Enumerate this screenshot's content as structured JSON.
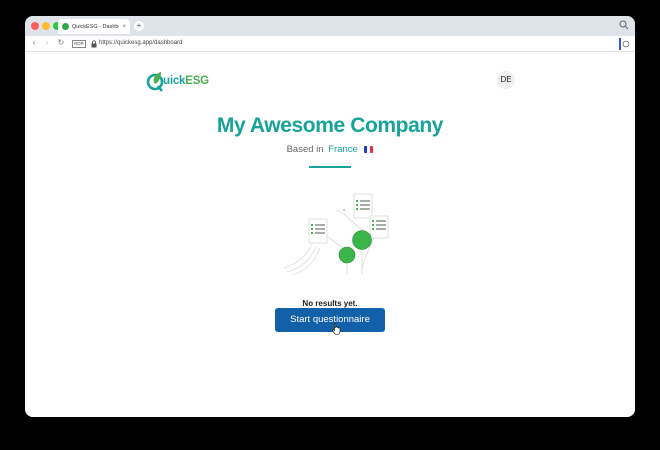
{
  "browser": {
    "tab_title": "QuickESG - Dashboard",
    "tab_close": "×",
    "new_tab": "+",
    "reader_badge": "RDR",
    "url": "https://quickesg.app/dashboard",
    "nav_back": "‹",
    "nav_forward": "›",
    "nav_reload": "↻"
  },
  "app": {
    "logo_q_part": "uick",
    "logo_esg_part": "ESG",
    "language": "DE"
  },
  "company": {
    "name": "My Awesome Company",
    "based_prefix": "Based in",
    "country": "France"
  },
  "main": {
    "empty_message": "No results yet.",
    "start_button": "Start questionnaire"
  },
  "colors": {
    "brand_teal": "#17a39a",
    "brand_green": "#4caf50",
    "button_blue": "#1261a8"
  }
}
